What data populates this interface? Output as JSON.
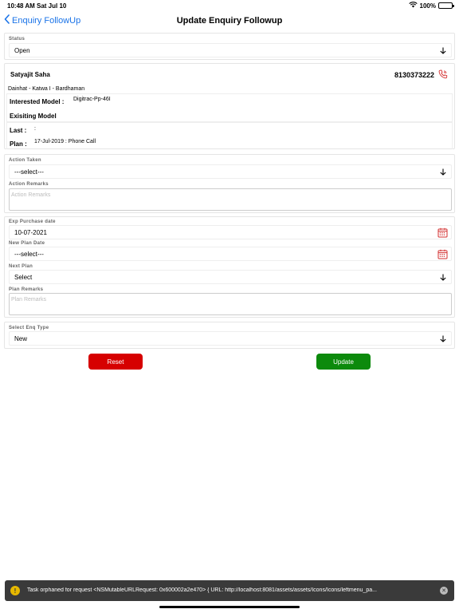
{
  "status_bar": {
    "time": "10:48 AM",
    "date": "Sat Jul 10",
    "battery": "100%"
  },
  "nav": {
    "back_label": "Enquiry FollowUp",
    "title": "Update Enquiry Followup"
  },
  "status": {
    "label": "Status",
    "value": "Open"
  },
  "lead": {
    "name": "Satyajit Saha",
    "phone": "8130373222",
    "location": "Dainhat - Katwa I - Bardhaman",
    "interested_model_label": "Interested Model :",
    "interested_model_value": "Digitrac-Pp-46I",
    "existing_model_label": "Exisiting Model",
    "last_label": "Last :",
    "last_value": ":",
    "plan_label": "Plan :",
    "plan_value": "17-Jul-2019 : Phone Call"
  },
  "action": {
    "taken_label": "Action Taken",
    "taken_value": "---select---",
    "remarks_label": "Action Remarks",
    "remarks_placeholder": "Action Remarks"
  },
  "plan": {
    "exp_purchase_label": "Exp Purchase date",
    "exp_purchase_value": "10-07-2021",
    "new_plan_date_label": "New Plan Date",
    "new_plan_date_value": "---select---",
    "next_plan_label": "Next Plan",
    "next_plan_value": "Select",
    "remarks_label": "Plan Remarks",
    "remarks_placeholder": "Plan Remarks"
  },
  "enq_type": {
    "label": "Select Enq Type",
    "value": "New"
  },
  "buttons": {
    "reset": "Reset",
    "update": "Update"
  },
  "toast": {
    "message": "Task orphaned for request <NSMutableURLRequest: 0x600002a2e470> { URL: http://localhost:8081/assets/assets/Icons/Icons/leftmenu_pa..."
  },
  "colors": {
    "accent": "#1a73e8",
    "reset": "#d60000",
    "update": "#0c8a0c",
    "calendar": "#d32f2f",
    "phone_icon": "#d32f2f"
  }
}
